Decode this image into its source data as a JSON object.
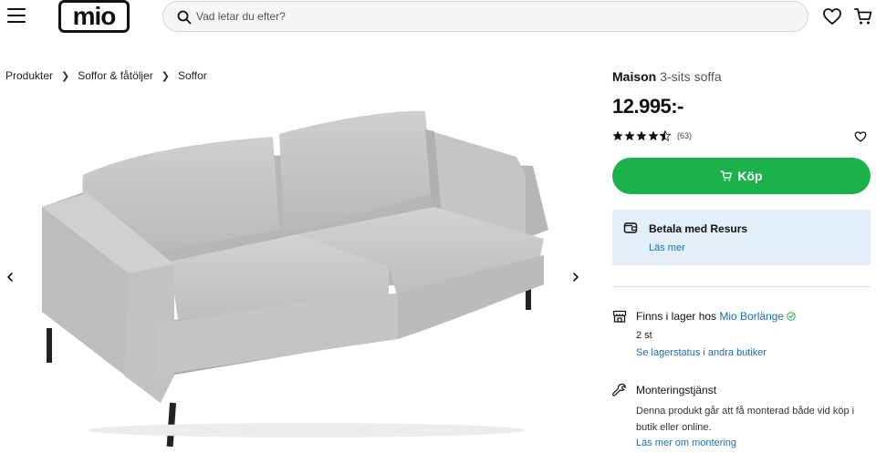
{
  "header": {
    "logo_text": "mio",
    "search_placeholder": "Vad letar du efter?"
  },
  "breadcrumb": [
    "Produkter",
    "Soffor & fåtöljer",
    "Soffor"
  ],
  "product": {
    "name": "Maison",
    "subtitle": "3-sits soffa",
    "price": "12.995:-",
    "rating": 4.5,
    "review_count": "(63)",
    "buy_label": "Köp"
  },
  "financing": {
    "title": "Betala med Resurs",
    "link": "Läs mer",
    "bg_color": "#e2eff9"
  },
  "stock": {
    "prefix": "Finns i lager hos",
    "store": "Mio Borlänge",
    "quantity": "2 st",
    "link": "Se lagerstatus i andra butiker"
  },
  "assembly": {
    "title": "Monteringstjänst",
    "description": "Denna produkt går att få monterad både vid köp i butik eller online.",
    "link": "Läs mer om montering"
  },
  "colors": {
    "accent_green": "#1cb24b",
    "link_blue": "#1c6eb6"
  },
  "icons": {
    "menu": "hamburger-icon",
    "search": "search-icon",
    "wishlist": "heart-icon",
    "cart": "cart-icon",
    "prev": "chevron-left-icon",
    "next": "chevron-right-icon",
    "wallet": "wallet-icon",
    "store": "store-icon",
    "wrench": "wrench-icon"
  }
}
